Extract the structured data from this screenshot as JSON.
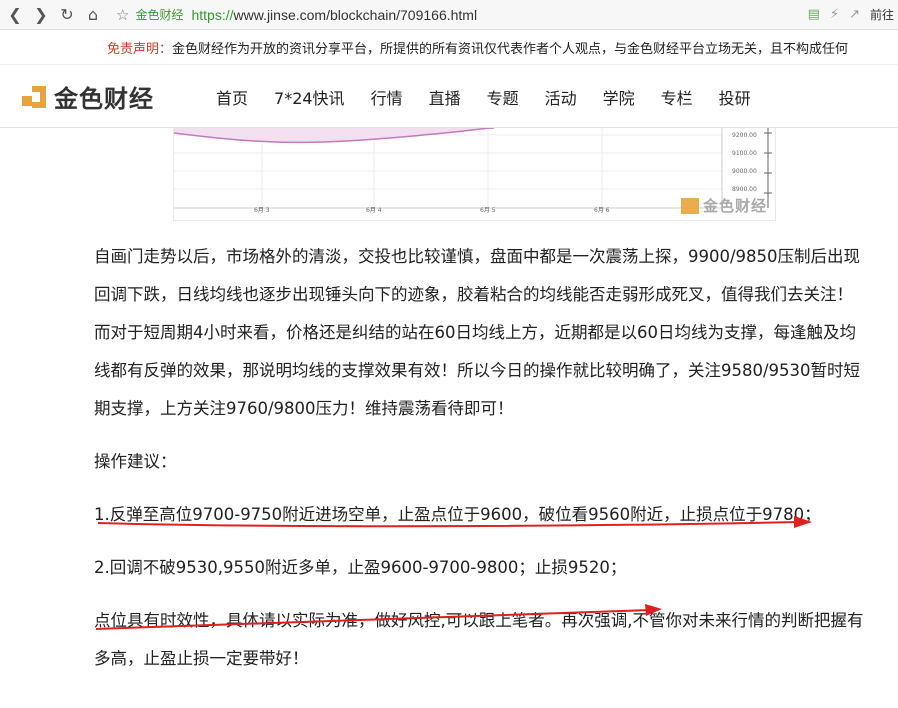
{
  "browser": {
    "back_icon": "chevron-left",
    "forward_icon": "chevron-right",
    "reload_icon": "reload",
    "home_icon": "home",
    "bookmark_icon": "star",
    "site_name": "金色财经",
    "url_protocol": "https://",
    "url_rest": "www.jinse.com/blockchain/709166.html",
    "forward_label": "前往"
  },
  "disclaimer": {
    "label": "免责声明：",
    "text": "金色财经作为开放的资讯分享平台，所提供的所有资讯仅代表作者个人观点，与金色财经平台立场无关，且不构成任何"
  },
  "header": {
    "logo_text": "金色财经",
    "nav": [
      "首页",
      "7*24快讯",
      "行情",
      "直播",
      "专题",
      "活动",
      "学院",
      "专栏",
      "投研"
    ]
  },
  "chart": {
    "y_ticks": [
      "9200.00",
      "9100.00",
      "9000.00",
      "8900.00"
    ],
    "x_ticks": [
      "6月 3",
      "6月 4",
      "6月 5",
      "6月 6"
    ],
    "watermark": "金色财经"
  },
  "article": {
    "p1": "自画门走势以后，市场格外的清淡，交投也比较谨慎，盘面中都是一次震荡上探，9900/9850压制后出现回调下跌，日线均线也逐步出现锤头向下的迹象，胶着粘合的均线能否走弱形成死叉，值得我们去关注！而对于短周期4小时来看，价格还是纠结的站在60日均线上方，近期都是以60日均线为支撑，每逢触及均线都有反弹的效果，那说明均线的支撑效果有效！所以今日的操作就比较明确了，关注9580/9530暂时短期支撑，上方关注9760/9800压力！维持震荡看待即可！",
    "p2": "操作建议：",
    "p3": "1.反弹至高位9700-9750附近进场空单，止盈点位于9600，破位看9560附近，止损点位于9780；",
    "p4": "2.回调不破9530,9550附近多单，止盈9600-9700-9800；止损9520；",
    "p5": "点位具有时效性，具体请以实际为准，做好风控,可以跟上笔者。再次强调,不管你对未来行情的判断把握有多高，止盈止损一定要带好！"
  },
  "colors": {
    "accent_orange": "#e8a33a",
    "url_green": "#2e9b2e",
    "disclaimer_red": "#d23a2a",
    "annotation_red": "#e02020"
  }
}
